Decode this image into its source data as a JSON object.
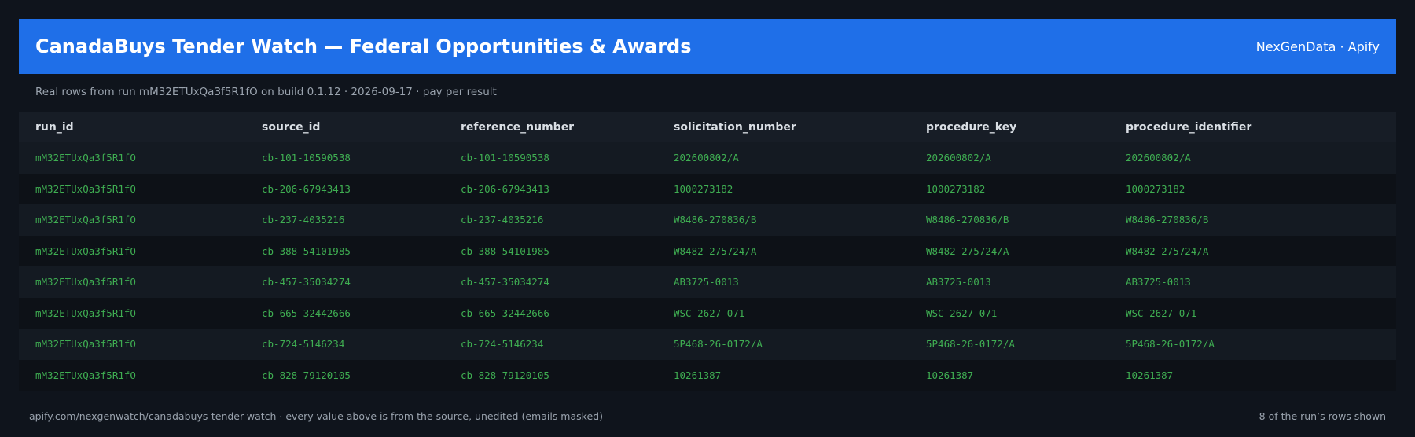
{
  "header": {
    "title": "CanadaBuys Tender Watch — Federal Opportunities & Awards",
    "brand": "NexGenData · Apify"
  },
  "subtitle": "Real rows from run mM32ETUxQa3f5R1fO on build 0.1.12 · 2026-09-17 · pay per result",
  "table": {
    "columns": [
      "run_id",
      "source_id",
      "reference_number",
      "solicitation_number",
      "procedure_key",
      "procedure_identifier"
    ],
    "rows": [
      [
        "mM32ETUxQa3f5R1fO",
        "cb-101-10590538",
        "cb-101-10590538",
        "202600802/A",
        "202600802/A",
        "202600802/A"
      ],
      [
        "mM32ETUxQa3f5R1fO",
        "cb-206-67943413",
        "cb-206-67943413",
        "1000273182",
        "1000273182",
        "1000273182"
      ],
      [
        "mM32ETUxQa3f5R1fO",
        "cb-237-4035216",
        "cb-237-4035216",
        "W8486-270836/B",
        "W8486-270836/B",
        "W8486-270836/B"
      ],
      [
        "mM32ETUxQa3f5R1fO",
        "cb-388-54101985",
        "cb-388-54101985",
        "W8482-275724/A",
        "W8482-275724/A",
        "W8482-275724/A"
      ],
      [
        "mM32ETUxQa3f5R1fO",
        "cb-457-35034274",
        "cb-457-35034274",
        "AB3725-0013",
        "AB3725-0013",
        "AB3725-0013"
      ],
      [
        "mM32ETUxQa3f5R1fO",
        "cb-665-32442666",
        "cb-665-32442666",
        "WSC-2627-071",
        "WSC-2627-071",
        "WSC-2627-071"
      ],
      [
        "mM32ETUxQa3f5R1fO",
        "cb-724-5146234",
        "cb-724-5146234",
        "5P468-26-0172/A",
        "5P468-26-0172/A",
        "5P468-26-0172/A"
      ],
      [
        "mM32ETUxQa3f5R1fO",
        "cb-828-79120105",
        "cb-828-79120105",
        "10261387",
        "10261387",
        "10261387"
      ]
    ]
  },
  "footer": {
    "source": "apify.com/nexgenwatch/canadabuys-tender-watch  ·  every value above is from the source, unedited (emails masked)",
    "count": "8 of the run’s rows shown"
  },
  "colors": {
    "accent": "#1f6fe8",
    "background": "#0f141c",
    "cell_text": "#3fae52"
  }
}
